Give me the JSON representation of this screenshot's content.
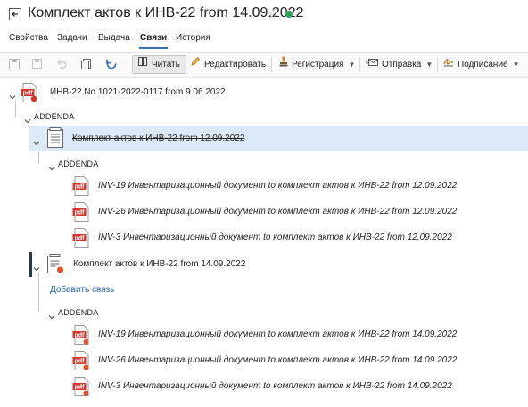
{
  "header": {
    "title": "Комплект актов к ИНВ-22 from 14.09.2022",
    "status_color": "#2da44e"
  },
  "tabs": [
    {
      "label": "Свойства"
    },
    {
      "label": "Задачи"
    },
    {
      "label": "Выдача"
    },
    {
      "label": "Связи",
      "active": true
    },
    {
      "label": "История"
    }
  ],
  "toolbar": {
    "read_label": "Читать",
    "edit_label": "Редактировать",
    "registration_label": "Регистрация",
    "send_label": "Отправка",
    "signing_label": "Подписание"
  },
  "tree": {
    "root_label": "ИНВ-22 No.1021-2022-0117 from 9.06.2022",
    "addenda_label": "ADDENDA",
    "set1": {
      "label": "Комплект актов к ИНВ-22 from 12.09.2022",
      "addenda_label": "ADDENDA",
      "items": [
        "INV-19 Инвентаризационный документ to комплект актов к ИНВ-22 from 12.09.2022",
        "INV-26 Инвентаризационный документ to комплект актов к ИНВ-22 from 12.09.2022",
        "INV-3 Инвентаризационный документ to комплект актов к ИНВ-22 from 12.09.2022"
      ]
    },
    "set2": {
      "label": "Комплект актов к ИНВ-22 from 14.09.2022",
      "add_link": "Добавить связь",
      "addenda_label": "ADDENDA",
      "items": [
        "INV-19 Инвентаризационный документ to комплект актов к ИНВ-22 from 14.09.2022",
        "INV-26 Инвентаризационный документ to комплект актов к ИНВ-22 from 14.09.2022",
        "INV-3 Инвентаризационный документ to комплект актов к ИНВ-22 from 14.09.2022"
      ]
    }
  }
}
